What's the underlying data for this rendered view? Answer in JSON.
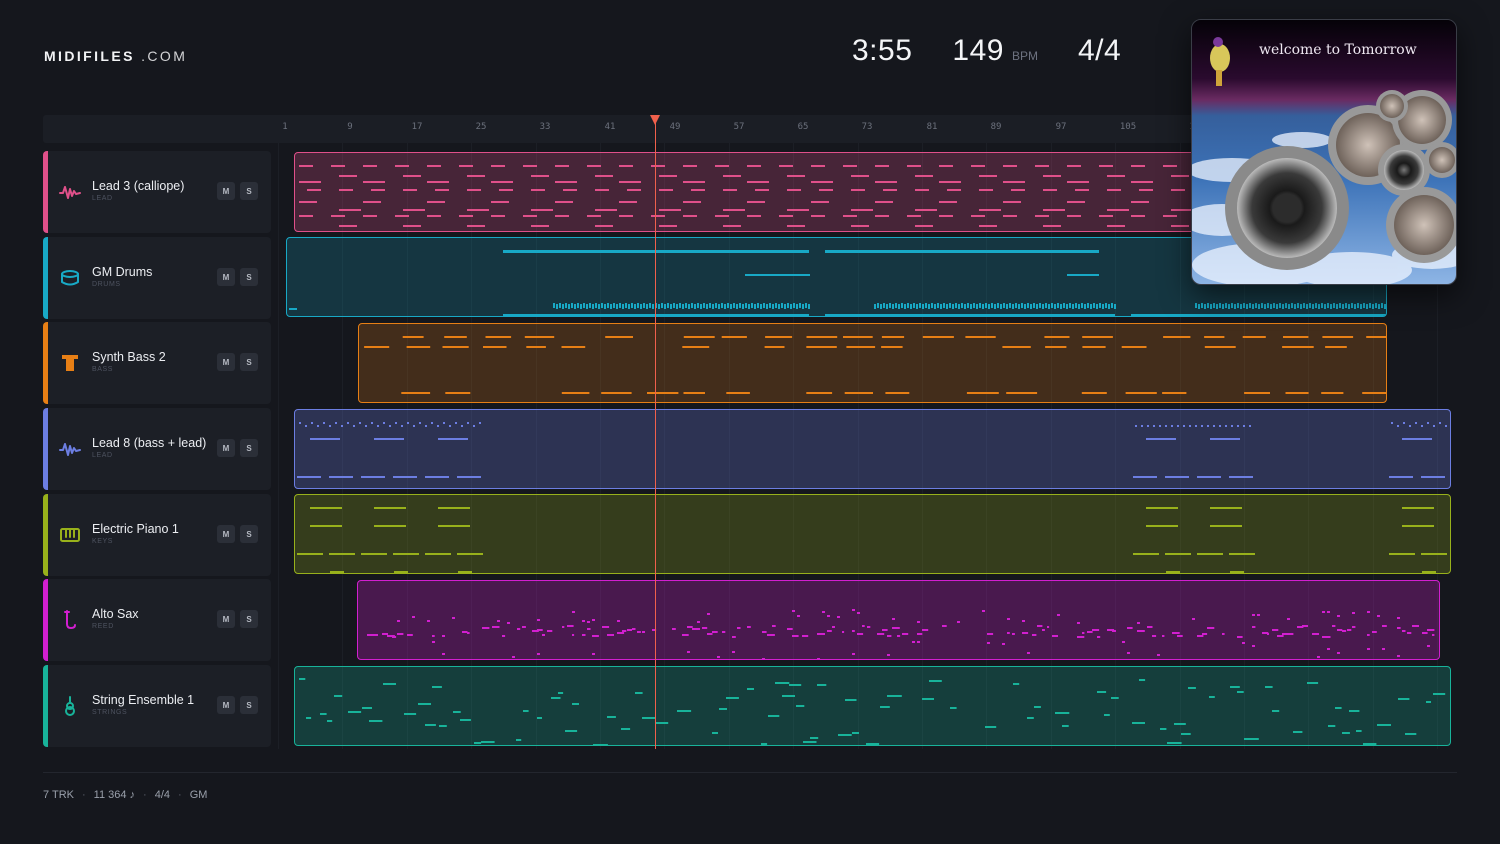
{
  "brand": {
    "bold": "MIDIFILES",
    "light": ".COM"
  },
  "stats": {
    "duration": "3:55",
    "tempo": "149",
    "tempo_unit": "BPM",
    "time_signature": "4/4"
  },
  "cover": {
    "title": "welcome to Tomorrow"
  },
  "ruler": {
    "ticks": [
      "1",
      "9",
      "17",
      "25",
      "33",
      "41",
      "49",
      "57",
      "65",
      "73",
      "81",
      "89",
      "97",
      "105",
      "1"
    ]
  },
  "tracks": [
    {
      "name": "Lead 3 (calliope)",
      "category": "LEAD",
      "color": "#e0508a",
      "icon": "waveform-icon",
      "mute": "M",
      "solo": "S"
    },
    {
      "name": "GM Drums",
      "category": "DRUMS",
      "color": "#18a9c6",
      "icon": "drum-icon",
      "mute": "M",
      "solo": "S"
    },
    {
      "name": "Synth Bass 2",
      "category": "BASS",
      "color": "#e77f15",
      "icon": "bass-icon",
      "mute": "M",
      "solo": "S"
    },
    {
      "name": "Lead 8 (bass + lead)",
      "category": "LEAD",
      "color": "#6c7ee2",
      "icon": "waveform-icon",
      "mute": "M",
      "solo": "S"
    },
    {
      "name": "Electric Piano 1",
      "category": "KEYS",
      "color": "#98b11b",
      "icon": "keyboard-icon",
      "mute": "M",
      "solo": "S"
    },
    {
      "name": "Alto Sax",
      "category": "REED",
      "color": "#d21fd0",
      "icon": "saxophone-icon",
      "mute": "M",
      "solo": "S"
    },
    {
      "name": "String Ensemble 1",
      "category": "STRINGS",
      "color": "#18b39a",
      "icon": "violin-icon",
      "mute": "M",
      "solo": "S"
    }
  ],
  "footer": {
    "tracks": "7 TRK",
    "notes": "11 364 ♪",
    "time_signature": "4/4",
    "standard": "GM"
  }
}
